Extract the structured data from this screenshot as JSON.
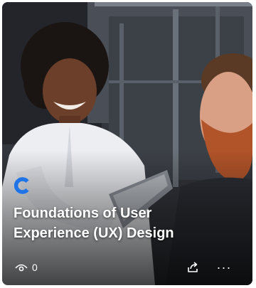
{
  "card": {
    "title": "Foundations of User Experience (UX) Design",
    "provider_icon": "coursera-c-icon",
    "provider_color": "#1f74e8",
    "views": "0",
    "view_icon": "eye-icon",
    "share_icon": "share-icon",
    "more_label": "···"
  }
}
